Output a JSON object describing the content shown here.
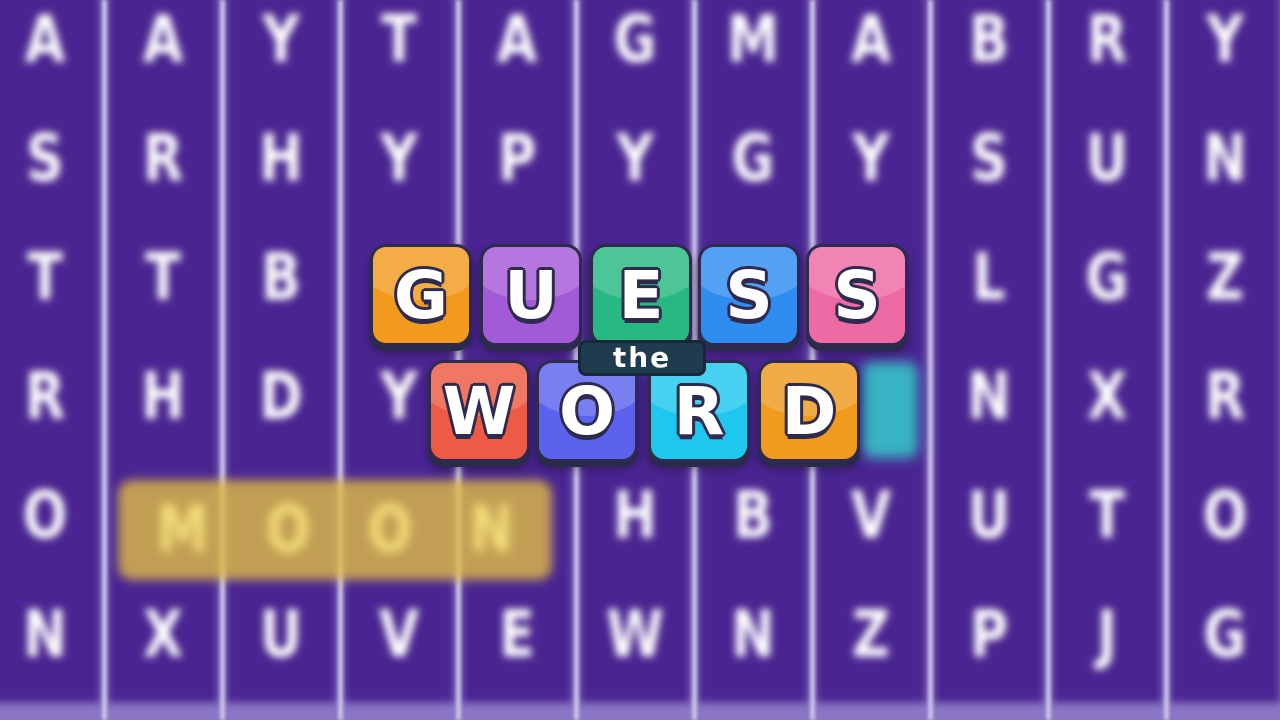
{
  "grid": {
    "rows": [
      [
        "A",
        "A",
        "Y",
        "T",
        "A",
        "G",
        "M",
        "A",
        "B",
        "R",
        "Y"
      ],
      [
        "S",
        "R",
        "H",
        "Y",
        "P",
        "Y",
        "G",
        "Y",
        "S",
        "U",
        "N"
      ],
      [
        "T",
        "T",
        "B",
        "",
        "",
        "",
        "",
        "",
        "L",
        "G",
        "Z"
      ],
      [
        "R",
        "H",
        "D",
        "Y",
        "",
        "",
        "",
        "",
        "N",
        "X",
        "R"
      ],
      [
        "O",
        "",
        "",
        "",
        "",
        "H",
        "B",
        "V",
        "U",
        "T",
        "O"
      ],
      [
        "N",
        "X",
        "U",
        "V",
        "E",
        "W",
        "N",
        "Z",
        "P",
        "J",
        "G"
      ]
    ]
  },
  "highlight": {
    "letters": [
      "M",
      "O",
      "O",
      "N"
    ],
    "color": "#dcb946"
  },
  "logo": {
    "row1": [
      {
        "letter": "G",
        "color": "#f29a1e"
      },
      {
        "letter": "U",
        "color": "#a35ad8"
      },
      {
        "letter": "E",
        "color": "#27b981"
      },
      {
        "letter": "S",
        "color": "#2f8cf0"
      },
      {
        "letter": "S",
        "color": "#ee6aa5"
      }
    ],
    "badge": "the",
    "row2": [
      {
        "letter": "W",
        "color": "#ee5a44"
      },
      {
        "letter": "O",
        "color": "#5b63ee"
      },
      {
        "letter": "R",
        "color": "#1ec7ee"
      },
      {
        "letter": "D",
        "color": "#f09a1e"
      }
    ]
  },
  "colors": {
    "cell": "#4a2591",
    "background": "#8a76c4"
  }
}
